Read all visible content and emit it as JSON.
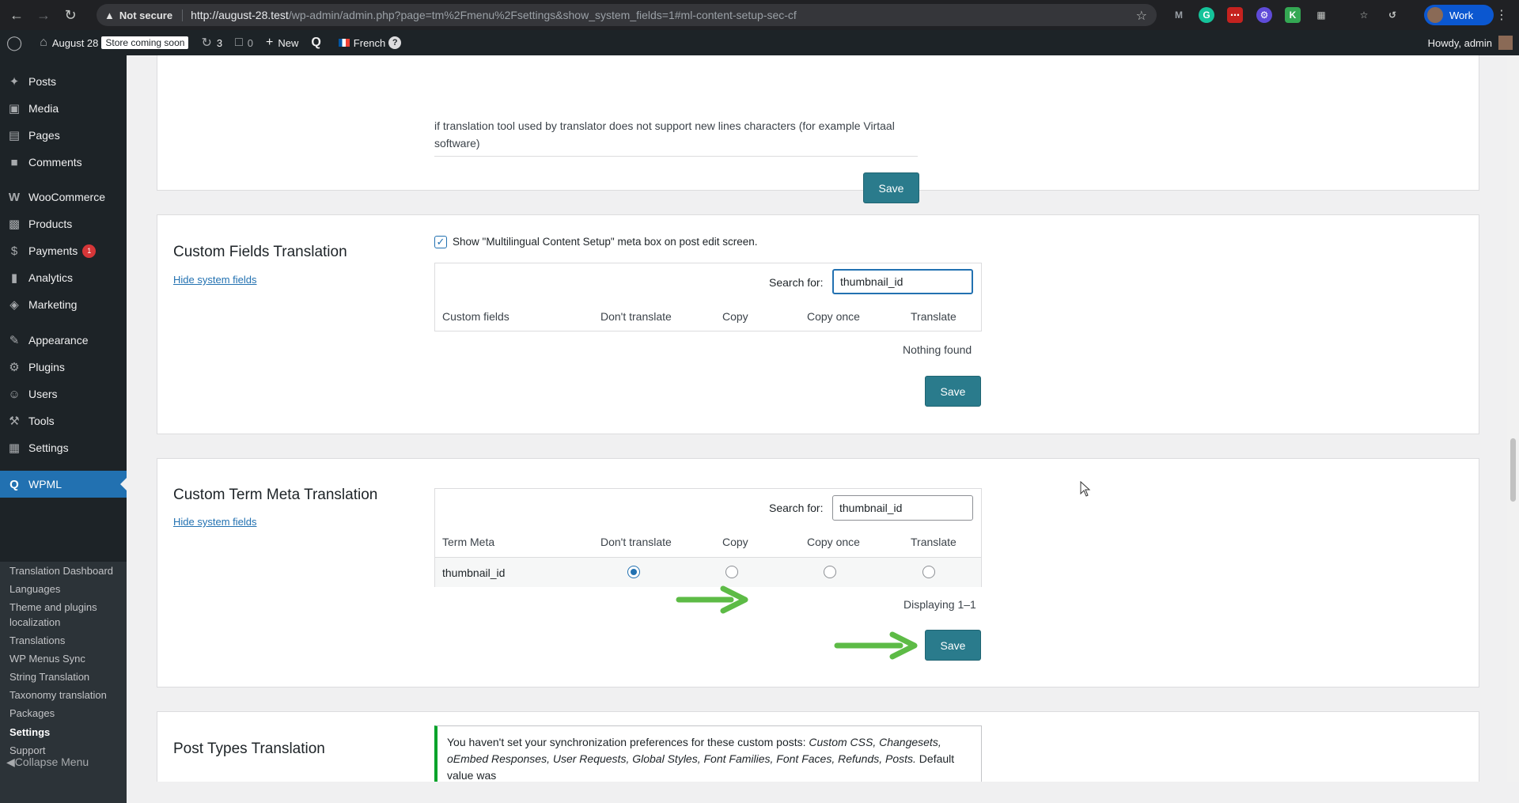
{
  "browser": {
    "security": "Not secure",
    "url_host": "http://august-28.test",
    "url_path": "/wp-admin/admin.php?page=tm%2Fmenu%2Fsettings&show_system_fields=1#ml-content-setup-sec-cf",
    "profile": "Work"
  },
  "adminbar": {
    "site": "August 28",
    "store_badge": "Store coming soon",
    "updates": "3",
    "comments": "0",
    "new": "New",
    "language": "French",
    "help": "?",
    "howdy": "Howdy, admin"
  },
  "sidebar": {
    "items": [
      {
        "label": "Posts",
        "icon": "pin-icon"
      },
      {
        "label": "Media",
        "icon": "media-icon"
      },
      {
        "label": "Pages",
        "icon": "pages-icon"
      },
      {
        "label": "Comments",
        "icon": "comment-icon"
      },
      {
        "label": "WooCommerce",
        "icon": "woo-icon"
      },
      {
        "label": "Products",
        "icon": "products-icon"
      },
      {
        "label": "Payments",
        "icon": "payments-icon",
        "badge": "1"
      },
      {
        "label": "Analytics",
        "icon": "analytics-icon"
      },
      {
        "label": "Marketing",
        "icon": "megaphone-icon"
      },
      {
        "label": "Appearance",
        "icon": "brush-icon"
      },
      {
        "label": "Plugins",
        "icon": "plugin-icon"
      },
      {
        "label": "Users",
        "icon": "user-icon"
      },
      {
        "label": "Tools",
        "icon": "wrench-icon"
      },
      {
        "label": "Settings",
        "icon": "settings-icon"
      },
      {
        "label": "WPML",
        "icon": "wpml-icon"
      }
    ],
    "submenu": [
      "Translation Dashboard",
      "Languages",
      "Theme and plugins localization",
      "Translations",
      "WP Menus Sync",
      "String Translation",
      "Taxonomy translation",
      "Packages",
      "Settings",
      "Support"
    ],
    "collapse": "Collapse Menu"
  },
  "top_section": {
    "hint": "if translation tool used by translator does not support new lines characters (for example Virtaal software)",
    "save": "Save"
  },
  "custom_fields": {
    "title": "Custom Fields Translation",
    "hide_link": "Hide system fields",
    "checkbox_label": "Show \"Multilingual Content Setup\" meta box on post edit screen.",
    "search_label": "Search for:",
    "search_value": "thumbnail_id",
    "columns": [
      "Custom fields",
      "Don't translate",
      "Copy",
      "Copy once",
      "Translate"
    ],
    "empty": "Nothing found",
    "save": "Save"
  },
  "term_meta": {
    "title": "Custom Term Meta Translation",
    "hide_link": "Hide system fields",
    "search_label": "Search for:",
    "search_value": "thumbnail_id",
    "columns": [
      "Term Meta",
      "Don't translate",
      "Copy",
      "Copy once",
      "Translate"
    ],
    "rows": [
      {
        "name": "thumbnail_id",
        "selected": "Don't translate"
      }
    ],
    "displaying": "Displaying 1–1",
    "save": "Save"
  },
  "post_types": {
    "title": "Post Types Translation",
    "notice_plain_1": "You haven't set your synchronization preferences for these custom posts: ",
    "notice_italic_1": "Custom CSS, Changesets,",
    "notice_italic_2": "oEmbed Responses, User Requests, Global Styles, Font Families, Font Faces, Refunds, Posts.",
    "notice_plain_2": " Default value was"
  },
  "colors": {
    "accent": "#2271b1",
    "button": "#2a7b8c",
    "arrow": "#5dbb46",
    "sidebar": "#1d2327"
  }
}
